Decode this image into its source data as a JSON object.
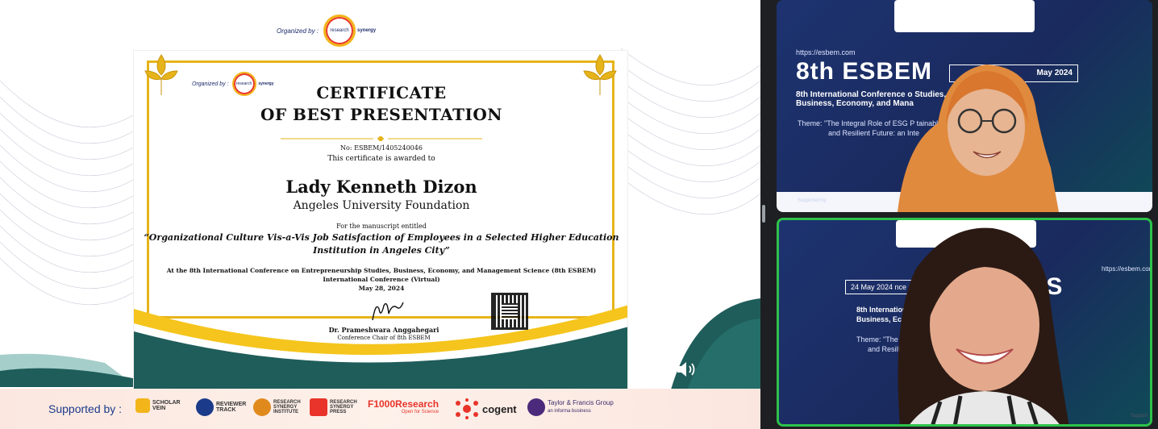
{
  "shared_screen": {
    "organized_by_label": "Organized by :",
    "organizer_logo_text": "research",
    "organizer_logo_text2": "synergy",
    "certificate": {
      "organized_by_label": "Organized by :",
      "title_line1": "CERTIFICATE",
      "title_line2": "OF BEST PRESENTATION",
      "number": "No: ESBEM/1405240046",
      "awarded_text": "This certificate is awarded to",
      "recipient_name": "Lady Kenneth Dizon",
      "institution": "Angeles University Foundation",
      "manuscript_label": "For the manuscript entitled",
      "manuscript_title_line1": "“Organizational Culture Vis-a-Vis Job Satisfaction of Employees in a Selected Higher Education",
      "manuscript_title_line2": "Institution in Angeles City”",
      "conference_line1": "At the 8th International Conference on Entrepreneurship Studies, Business, Economy, and Management Science (8th ESBEM)",
      "conference_line2": "International Conference (Virtual)",
      "date": "May 28, 2024",
      "signer_name": "Dr. Prameshwara Anggahegari",
      "signer_role": "Conference Chair of 8th ESBEM"
    },
    "supported_by_label": "Supported by :",
    "sponsors": [
      {
        "line1": "SCHOLAR",
        "line2": "VEIN"
      },
      {
        "line1": "REVIEWER",
        "line2": "TRACK"
      },
      {
        "line1": "RESEARCH",
        "line2": "SYNERGY",
        "line3": "INSTITUTE"
      },
      {
        "line1": "RESEARCH",
        "line2": "SYNERGY",
        "line3": "PRESS"
      },
      {
        "line1": "F1000Research",
        "line2": "Open for Science"
      },
      {
        "line1": "cogent"
      },
      {
        "line1": "Taylor & Francis Group",
        "line2": "an informa business"
      }
    ]
  },
  "video_tiles": [
    {
      "url": "https://esbem.com",
      "event": "8th ESBEM",
      "date_box": "May 2024",
      "line1": "8th International Conference o         Studies,",
      "line2": "Business, Economy, and Mana",
      "theme1": "Theme: \"The Integral Role of ESG P            tainable",
      "theme2": "and Resilient Future: an Inte",
      "supported": "Supported by"
    },
    {
      "url": "https://esbem.com",
      "event_left": "8th ES",
      "date_box": "24 May 2024    nce : 28 May 2024",
      "line1": "8th Internationa         urship Studies,",
      "line2": "Business, Econo",
      "theme1": "Theme: \"The Integ           a Sustainable",
      "theme2": "and Resili",
      "supported": "Support"
    }
  ],
  "colors": {
    "active_speaker_border": "#2ec24a",
    "certificate_gold": "#e6b41a",
    "certificate_teal": "#1f5d5a",
    "slide_navy": "#1a2a5e"
  }
}
